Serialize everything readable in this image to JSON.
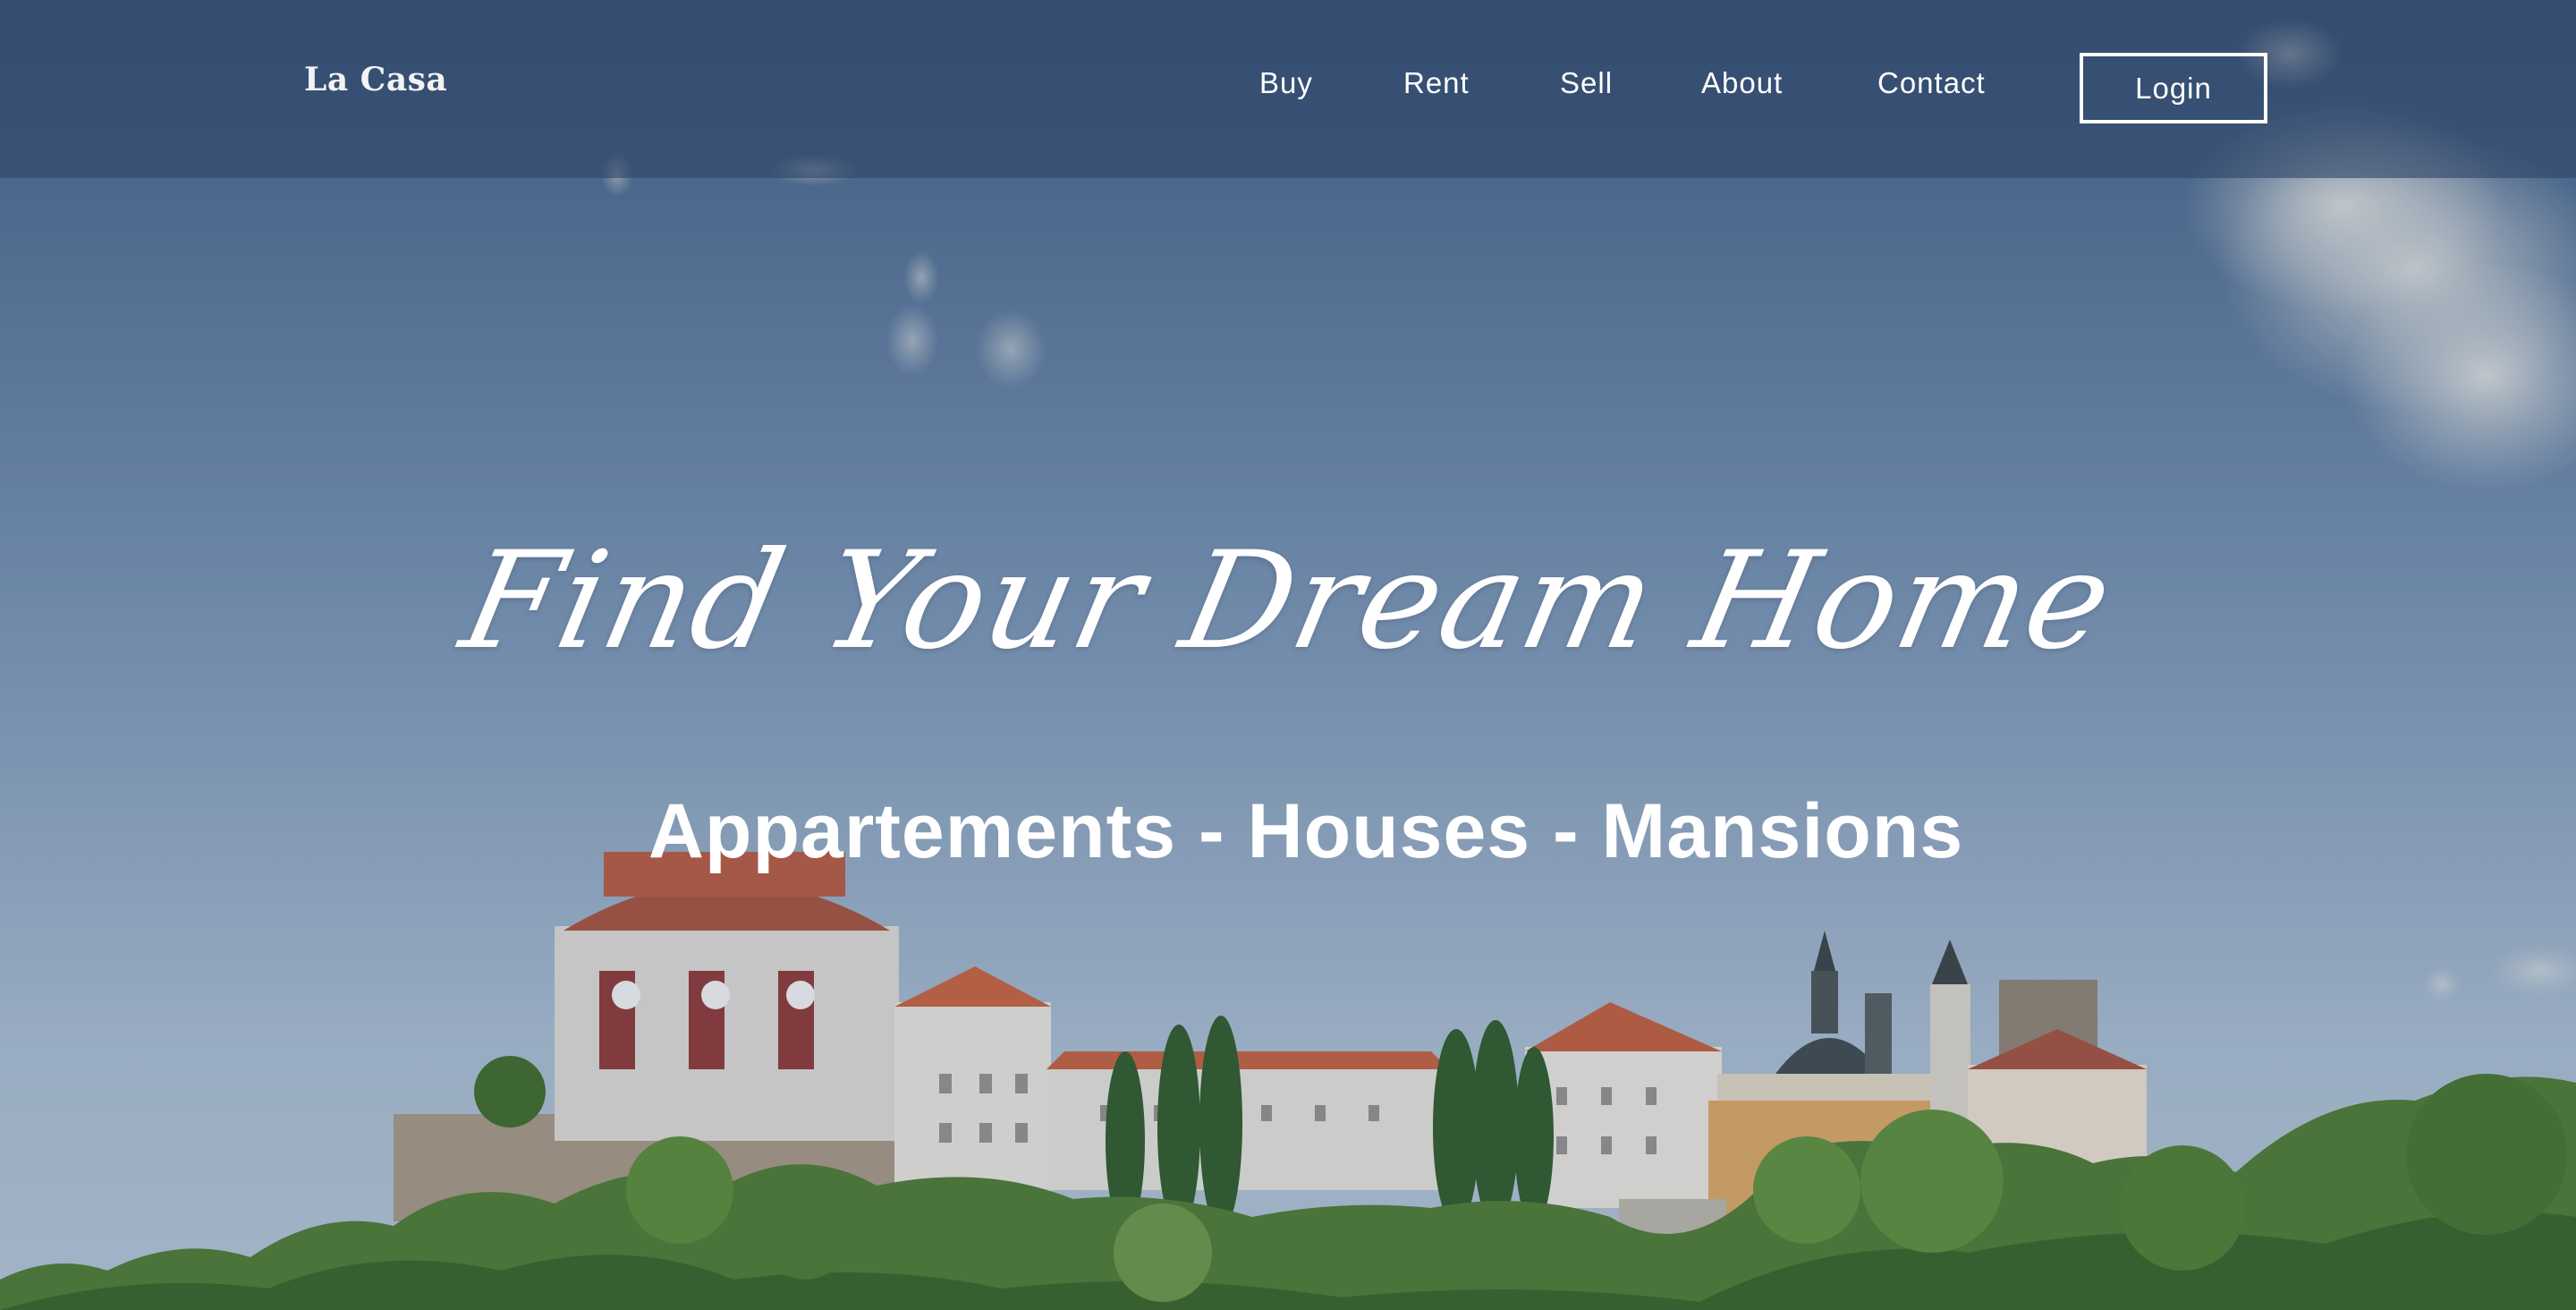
{
  "nav": {
    "brand": "La Casa",
    "links": [
      {
        "label": "Buy"
      },
      {
        "label": "Rent"
      },
      {
        "label": "Sell"
      },
      {
        "label": "About"
      },
      {
        "label": "Contact"
      }
    ],
    "login_label": "Login"
  },
  "hero": {
    "headline": "Find Your Dream Home",
    "subheadline": "Appartements - Houses - Mansions",
    "background": "castle-on-hill-photo"
  },
  "colors": {
    "sky_top": "#4b6a90",
    "sky_bottom": "#a9bdd2",
    "navbar": "#2e4668",
    "roof": "#b8563f",
    "foliage": "#4c7a30",
    "text": "#ffffff"
  }
}
